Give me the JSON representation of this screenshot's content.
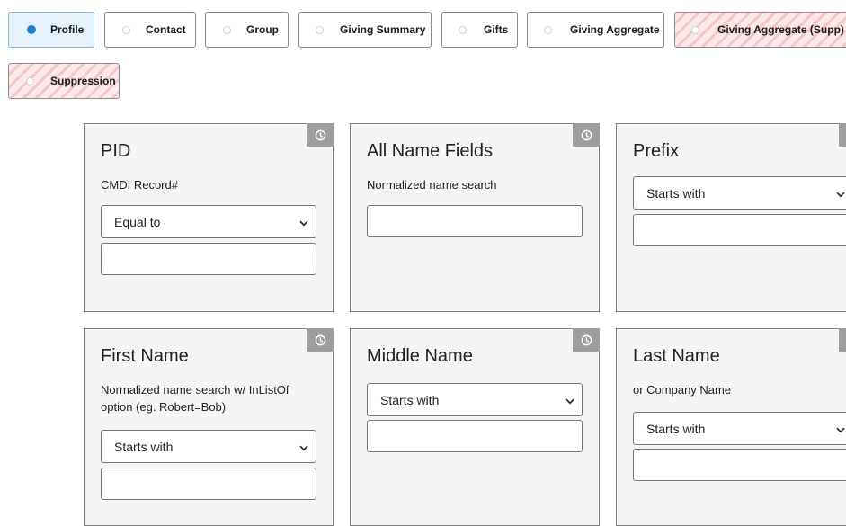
{
  "tabs": [
    {
      "label": "Profile",
      "state": "active"
    },
    {
      "label": "Contact",
      "state": "normal"
    },
    {
      "label": "Group",
      "state": "normal"
    },
    {
      "label": "Giving Summary",
      "state": "normal"
    },
    {
      "label": "Gifts",
      "state": "normal"
    },
    {
      "label": "Giving Aggregate",
      "state": "normal"
    },
    {
      "label": "Giving Aggregate (Supp)",
      "state": "striped"
    },
    {
      "label": "Suppression",
      "state": "striped"
    }
  ],
  "cards": [
    {
      "title": "PID",
      "description": "CMDI Record#",
      "select_value": "Equal to",
      "input_value": "",
      "has_clock": true
    },
    {
      "title": "All Name Fields",
      "description": "Normalized name search",
      "select_value": "",
      "input_value": "",
      "has_clock": true
    },
    {
      "title": "Prefix",
      "description": "",
      "select_value": "Starts with",
      "input_value": "",
      "has_clock": true
    },
    {
      "title": "First Name",
      "description": "Normalized name search w/ InListOf option (eg. Robert=Bob)",
      "select_value": "Starts with",
      "input_value": "",
      "has_clock": true
    },
    {
      "title": "Middle Name",
      "description": "",
      "select_value": "Starts with",
      "input_value": "",
      "has_clock": true
    },
    {
      "title": "Last Name",
      "description": "or Company Name",
      "select_value": "Starts with",
      "input_value": "",
      "has_clock": true
    }
  ],
  "colors": {
    "active_tab_bg": "#e6f2fb",
    "active_radio": "#1f7fd3",
    "stripe_light": "#fbe9e9",
    "stripe_dark": "#f3c7c7",
    "card_bg": "#f5f5f5",
    "clock_badge": "#9e9e9e"
  },
  "icons": {
    "tab_radio": "radio-icon",
    "card_history": "clock-icon",
    "select_caret": "chevron-down-icon"
  }
}
